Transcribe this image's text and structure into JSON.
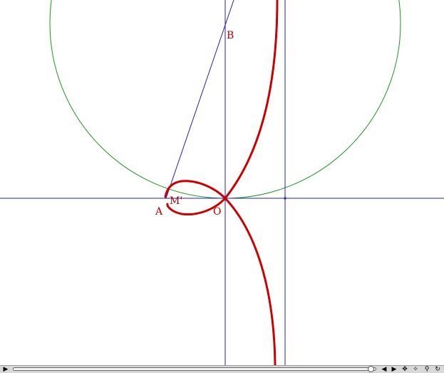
{
  "labels": {
    "point_b": "B",
    "point_m": "M'",
    "point_a": "A",
    "point_o": "O"
  },
  "icons": {
    "play": "play-icon",
    "step_back": "step-back-icon",
    "step_forward": "step-forward-icon",
    "move": "move-icon",
    "center": "center-icon",
    "zoom": "zoom-icon",
    "rotate": "rotate-icon"
  },
  "colors": {
    "curve": "#cc0000",
    "lines": "#2020c0",
    "circle": "#1a9a1a",
    "labels": "#b00000"
  }
}
